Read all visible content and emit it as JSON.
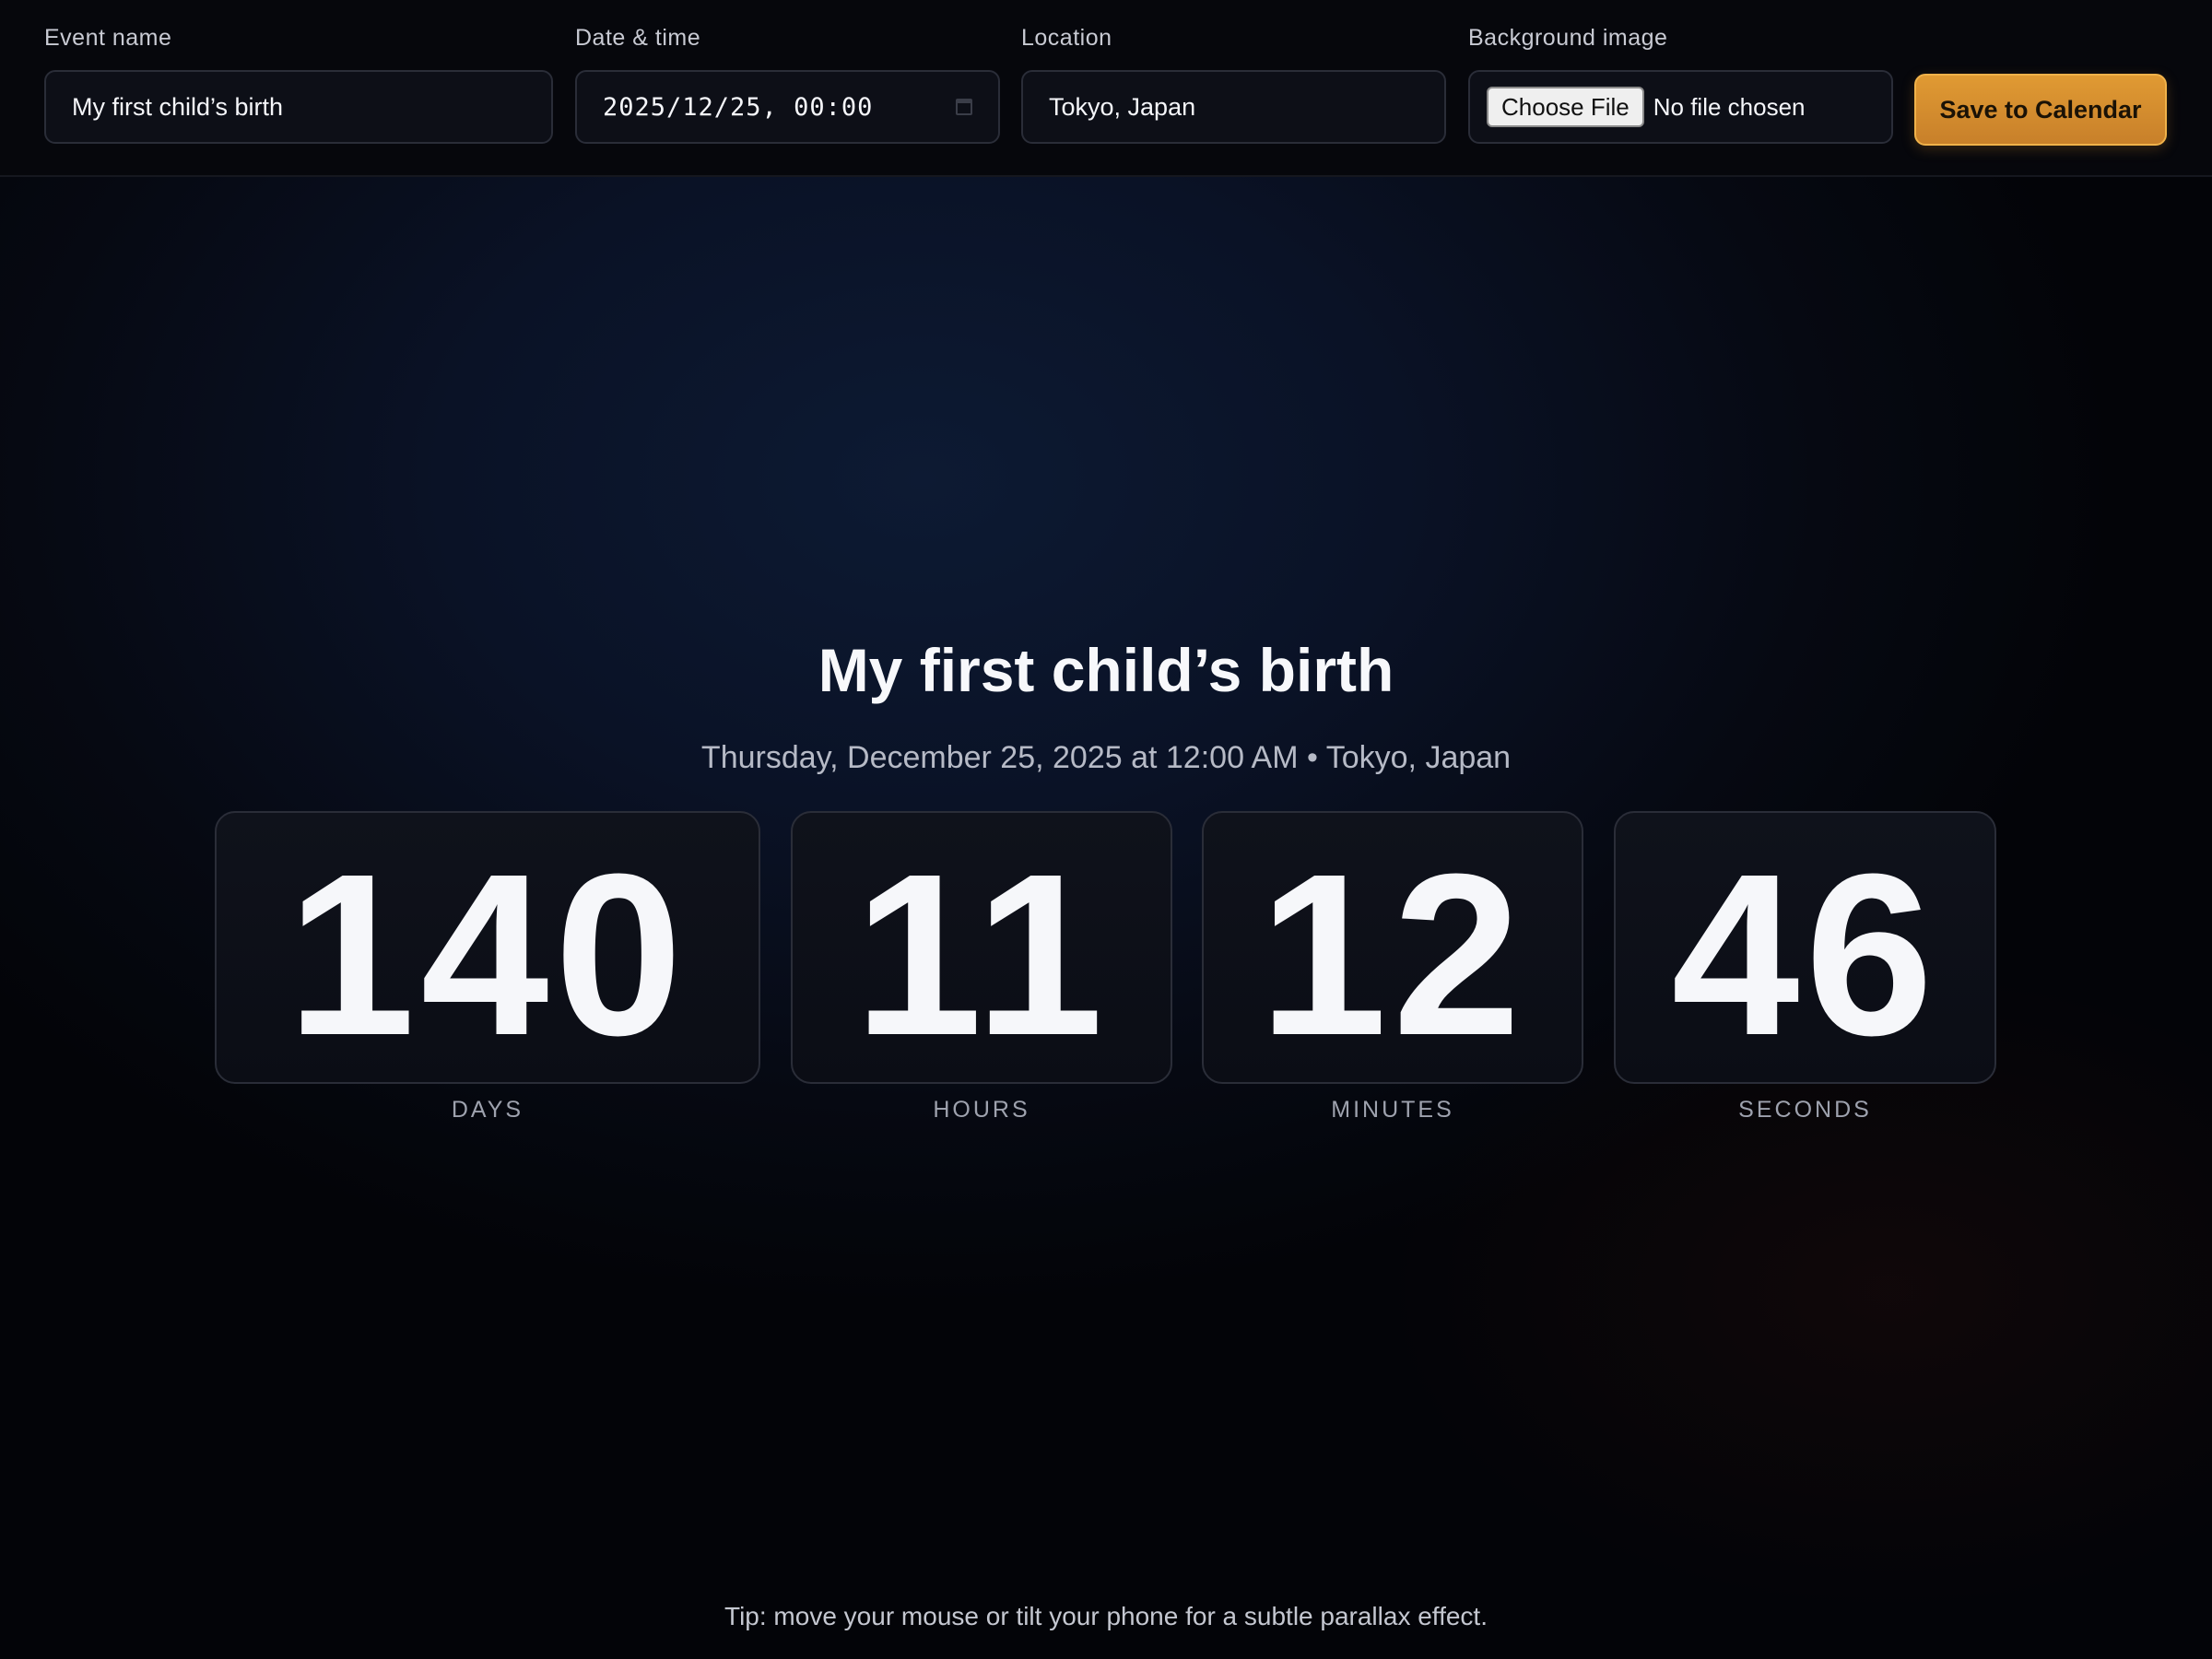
{
  "toolbar": {
    "event_name": {
      "label": "Event name",
      "value": "My first child’s birth"
    },
    "date_time": {
      "label": "Date & time",
      "value": "2025/12/25, 00:00"
    },
    "location": {
      "label": "Location",
      "value": "Tokyo, Japan"
    },
    "background_image": {
      "label": "Background image",
      "button": "Choose File",
      "status": "No file chosen"
    },
    "save_label": "Save to Calendar"
  },
  "countdown": {
    "title": "My first child’s birth",
    "subtitle": "Thursday, December 25, 2025 at 12:00 AM • Tokyo, Japan",
    "units": [
      {
        "value": "140",
        "label": "DAYS"
      },
      {
        "value": "11",
        "label": "HOURS"
      },
      {
        "value": "12",
        "label": "MINUTES"
      },
      {
        "value": "46",
        "label": "SECONDS"
      }
    ]
  },
  "tip": "Tip: move your mouse or tilt your phone for a subtle parallax effect.",
  "colors": {
    "accent": "#d8902f",
    "background": "#060912",
    "tile": "#0d0f17",
    "text": "#f6f7fa"
  },
  "icons": {
    "date_picker": "calendar-icon"
  }
}
